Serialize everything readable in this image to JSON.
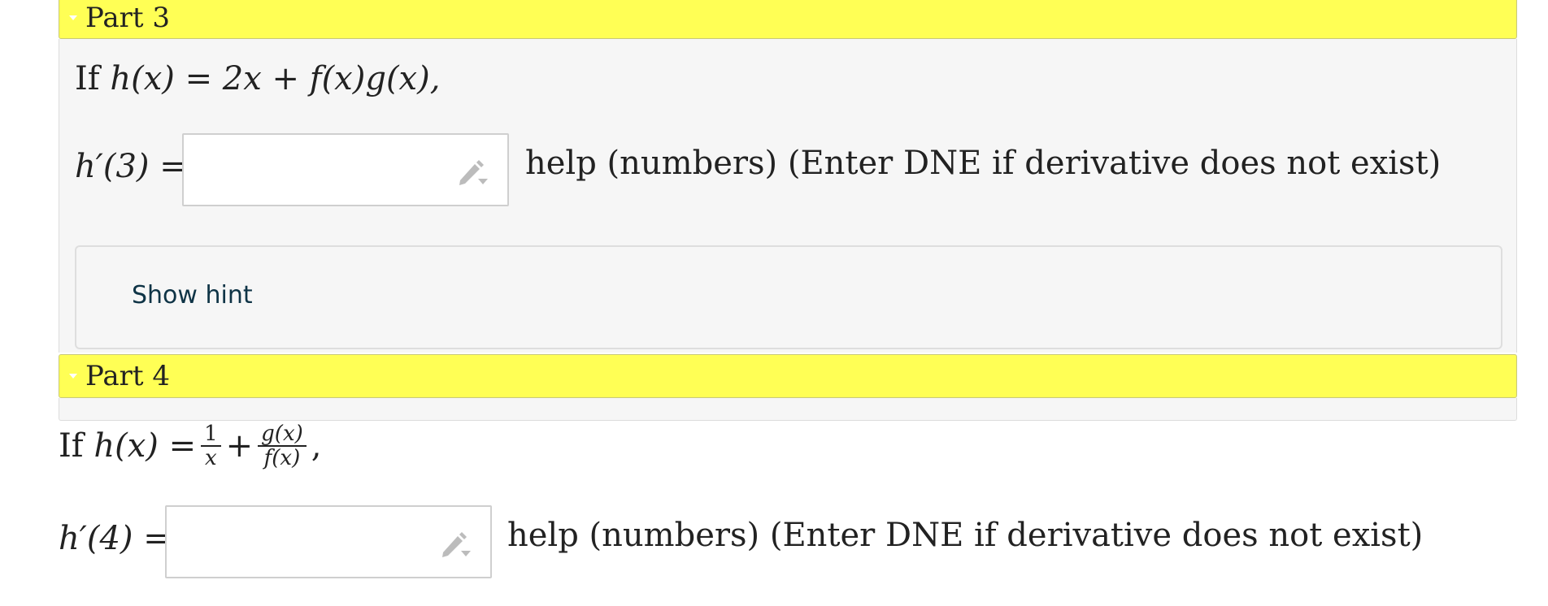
{
  "part3": {
    "title": "Part 3",
    "statement_prefix": "If",
    "statement_math": "h(x) = 2x + f(x)g(x),",
    "answer_label": "h′(3) =",
    "answer_value": "",
    "help_text": "help (numbers) (Enter DNE if derivative does not exist)",
    "hint_label": "Show hint"
  },
  "part4": {
    "title": "Part 4",
    "statement_prefix": "If",
    "statement_math_lhs": "h(x) =",
    "frac1_num": "1",
    "frac1_den": "x",
    "plus": "+",
    "frac2_num": "g(x)",
    "frac2_den": "f(x)",
    "statement_tail": ",",
    "answer_label": "h′(4) =",
    "answer_value": "",
    "help_text": "help (numbers) (Enter DNE if derivative does not exist)"
  },
  "icons": {
    "pencil": "pencil-icon",
    "caret": "caret-down-icon"
  },
  "colors": {
    "header_bg": "#ffff55",
    "panel_bg": "#f6f6f6",
    "hint_text": "#0f3446"
  }
}
